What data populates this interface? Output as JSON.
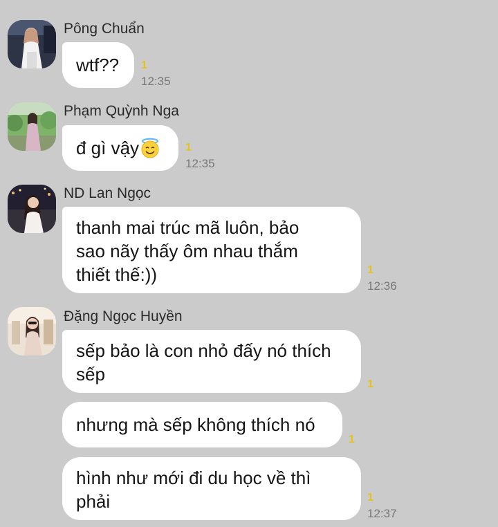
{
  "messages": [
    {
      "sender": "Pông Chuẩn",
      "bubbles": [
        {
          "text": "wtf??",
          "read_count": "1",
          "time": "12:35"
        }
      ]
    },
    {
      "sender": "Phạm Quỳnh Nga",
      "bubbles": [
        {
          "text": "đ gì vậy",
          "emoji": "smiling-face-with-halo",
          "read_count": "1",
          "time": "12:35"
        }
      ]
    },
    {
      "sender": "ND Lan Ngọc",
      "bubbles": [
        {
          "text": "thanh mai trúc mã luôn, bảo\nsao nãy thấy ôm nhau thắm\nthiết thế:))",
          "read_count": "1",
          "time": "12:36"
        }
      ]
    },
    {
      "sender": "Đặng Ngọc Huyền",
      "bubbles": [
        {
          "text": "sếp bảo là con nhỏ đấy nó thích\nsếp",
          "read_count": "1"
        },
        {
          "text": "nhưng mà sếp không thích nó",
          "read_count": "1"
        },
        {
          "text": "hình như mới đi du học về thì\nphải",
          "read_count": "1",
          "time": "12:37"
        }
      ]
    }
  ],
  "colors": {
    "background": "#cbcbcb",
    "bubble": "#ffffff",
    "read_count": "#e6c21e",
    "timestamp": "#777777"
  }
}
